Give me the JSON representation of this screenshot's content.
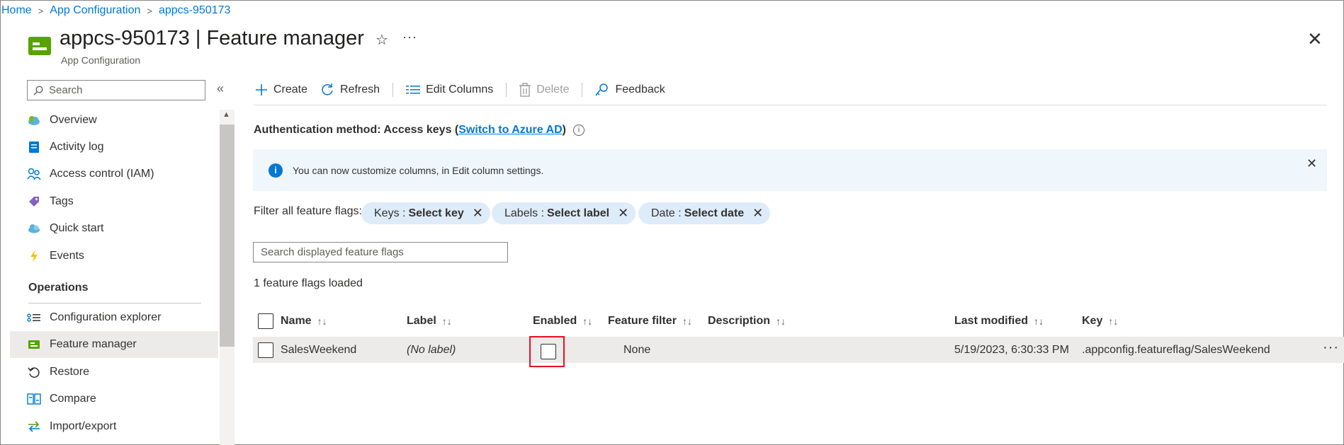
{
  "breadcrumb": {
    "home": "Home",
    "service": "App Configuration",
    "resource": "appcs-950173"
  },
  "header": {
    "title": "appcs-950173 | Feature manager",
    "subtitle": "App Configuration"
  },
  "sidebar": {
    "search_placeholder": "Search",
    "items": [
      {
        "label": "Overview",
        "icon": "cloud-icon"
      },
      {
        "label": "Activity log",
        "icon": "log-icon"
      },
      {
        "label": "Access control (IAM)",
        "icon": "people-icon"
      },
      {
        "label": "Tags",
        "icon": "tag-icon"
      },
      {
        "label": "Quick start",
        "icon": "cloud-icon"
      },
      {
        "label": "Events",
        "icon": "lightning-icon"
      }
    ],
    "section": "Operations",
    "operations": [
      {
        "label": "Configuration explorer",
        "icon": "config-icon"
      },
      {
        "label": "Feature manager",
        "icon": "feature-icon",
        "active": true
      },
      {
        "label": "Restore",
        "icon": "restore-icon"
      },
      {
        "label": "Compare",
        "icon": "compare-icon"
      },
      {
        "label": "Import/export",
        "icon": "arrows-icon"
      }
    ]
  },
  "toolbar": {
    "create": "Create",
    "refresh": "Refresh",
    "edit_columns": "Edit Columns",
    "delete": "Delete",
    "feedback": "Feedback"
  },
  "auth": {
    "prefix": "Authentication method: Access keys (",
    "link": "Switch to Azure AD",
    "suffix": ")"
  },
  "banner": {
    "text": "You can now customize columns, in Edit column settings."
  },
  "filters": {
    "label": "Filter all feature flags:",
    "pills": [
      {
        "key": "Keys :",
        "value": "Select key"
      },
      {
        "key": "Labels :",
        "value": "Select label"
      },
      {
        "key": "Date :",
        "value": "Select date"
      }
    ]
  },
  "search_flags": {
    "placeholder": "Search displayed feature flags"
  },
  "status": {
    "loaded": "1 feature flags loaded"
  },
  "table": {
    "columns": [
      "Name",
      "Label",
      "Enabled",
      "Feature filter",
      "Description",
      "Last modified",
      "Key"
    ],
    "rows": [
      {
        "name": "SalesWeekend",
        "label": "(No label)",
        "enabled": false,
        "feature_filter": "None",
        "description": "",
        "last_modified": "5/19/2023, 6:30:33 PM",
        "key": ".appconfig.featureflag/SalesWeekend"
      }
    ]
  },
  "colors": {
    "accent": "#0078d4",
    "highlight": "#e81123",
    "resource_icon": "#57a300"
  }
}
